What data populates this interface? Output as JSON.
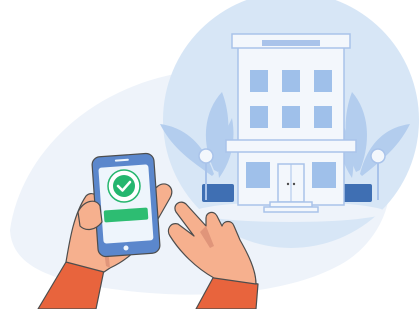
{
  "illustration": {
    "subject": "",
    "colors": {
      "background": "#ffffff",
      "blob_light": "#eef3fa",
      "circle_blue": "#d7e6f6",
      "building": "#f3f7fc",
      "building_outline": "#a9c3ea",
      "window": "#9fc0ea",
      "plant": "#b3cdee",
      "planter": "#3f6fb3",
      "phone_body": "#5b87cc",
      "phone_screen": "#eef5fc",
      "check_green": "#25b66e",
      "confirm_bar": "#2dbd72",
      "skin": "#f6b08e",
      "skin_shadow": "#e0957a",
      "sleeve": "#e8643d",
      "outline": "#4d4d4d"
    },
    "icons": [
      "checkmark-icon",
      "hotel-building",
      "smartphone",
      "hand"
    ]
  }
}
